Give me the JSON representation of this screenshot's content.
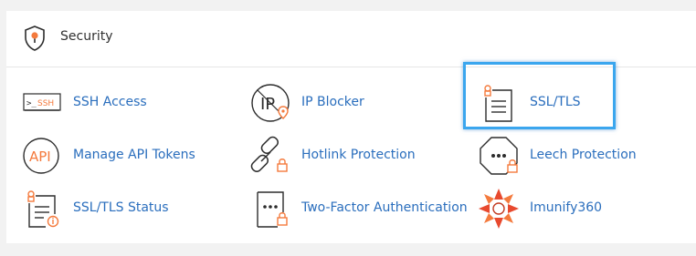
{
  "section": {
    "title": "Security",
    "header_icon": "shield-icon"
  },
  "tools": [
    {
      "label": "SSH Access",
      "icon": "ssh-icon",
      "icon_text": ">_SSH"
    },
    {
      "label": "IP Blocker",
      "icon": "ip-blocker-icon",
      "icon_text": "IP"
    },
    {
      "label": "SSL/TLS",
      "icon": "ssl-tls-icon",
      "selected": true
    },
    {
      "label": "Manage API Tokens",
      "icon": "api-icon",
      "icon_text": "API"
    },
    {
      "label": "Hotlink Protection",
      "icon": "hotlink-icon"
    },
    {
      "label": "Leech Protection",
      "icon": "leech-icon"
    },
    {
      "label": "SSL/TLS Status",
      "icon": "ssl-tls-status-icon"
    },
    {
      "label": "Two-Factor Authentication",
      "icon": "two-factor-icon"
    },
    {
      "label": "Imunify360",
      "icon": "imunify360-icon"
    }
  ],
  "colors": {
    "accent_orange": "#f47a3d",
    "link_blue": "#2a6ebd",
    "highlight_blue": "#3ba6ee",
    "icon_dark": "#2c2c2c"
  }
}
